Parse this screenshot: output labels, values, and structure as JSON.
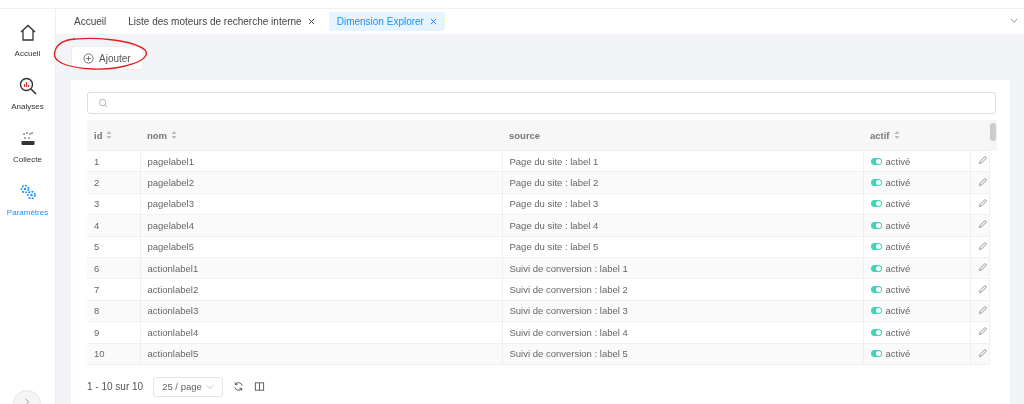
{
  "sidebar": {
    "items": [
      {
        "label": "Accueil",
        "kind": "home",
        "selected": false
      },
      {
        "label": "Analyses",
        "kind": "analyses",
        "selected": false
      },
      {
        "label": "Collecte",
        "kind": "collect",
        "selected": false
      },
      {
        "label": "Paramètres",
        "kind": "settings",
        "selected": true
      }
    ]
  },
  "tabs": [
    {
      "label": "Accueil",
      "closable": false,
      "selected": false
    },
    {
      "label": "Liste des moteurs de recherche interne",
      "closable": true,
      "selected": false
    },
    {
      "label": "Dimension Explorer",
      "closable": true,
      "selected": true
    }
  ],
  "add_button": {
    "label": "Ajouter"
  },
  "table": {
    "columns": [
      {
        "label": "id",
        "sortable": true
      },
      {
        "label": "nom",
        "sortable": true
      },
      {
        "label": "source",
        "sortable": false
      },
      {
        "label": "actif",
        "sortable": true
      }
    ],
    "rows": [
      {
        "id": "1",
        "nom": "pagelabel1",
        "source": "Page du site : label 1",
        "on": true,
        "status": "activé"
      },
      {
        "id": "2",
        "nom": "pagelabel2",
        "source": "Page du site : label 2",
        "on": true,
        "status": "activé"
      },
      {
        "id": "3",
        "nom": "pagelabel3",
        "source": "Page du site : label 3",
        "on": true,
        "status": "activé"
      },
      {
        "id": "4",
        "nom": "pagelabel4",
        "source": "Page du site : label 4",
        "on": true,
        "status": "activé"
      },
      {
        "id": "5",
        "nom": "pagelabel5",
        "source": "Page du site : label 5",
        "on": true,
        "status": "activé"
      },
      {
        "id": "6",
        "nom": "actionlabel1",
        "source": "Suivi de conversion : label 1",
        "on": true,
        "status": "activé"
      },
      {
        "id": "7",
        "nom": "actionlabel2",
        "source": "Suivi de conversion : label 2",
        "on": true,
        "status": "activé"
      },
      {
        "id": "8",
        "nom": "actionlabel3",
        "source": "Suivi de conversion : label 3",
        "on": true,
        "status": "activé"
      },
      {
        "id": "9",
        "nom": "actionlabel4",
        "source": "Suivi de conversion : label 4",
        "on": true,
        "status": "activé"
      },
      {
        "id": "10",
        "nom": "actionlabel5",
        "source": "Suivi de conversion : label 5",
        "on": true,
        "status": "activé"
      }
    ]
  },
  "pagination": {
    "summary": "1 - 10 sur 10",
    "page_size": "25 / page"
  }
}
